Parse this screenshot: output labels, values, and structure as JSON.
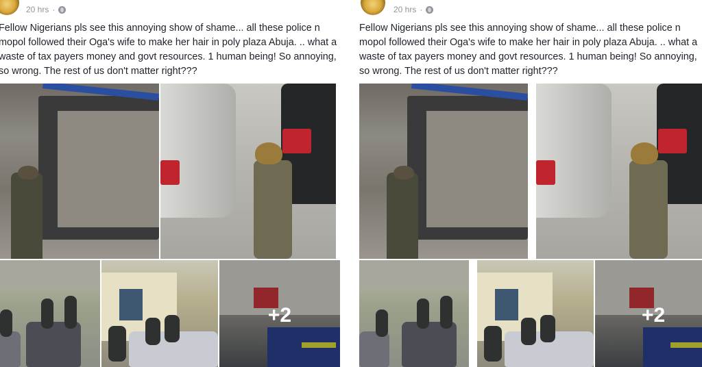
{
  "posts": [
    {
      "time": "20 hrs",
      "separator": "·",
      "privacy_icon": "globe-icon",
      "text": "Fellow Nigerians pls see this annoying show of shame... all these police n\nmopol followed their Oga's wife to make her hair in poly plaza Abuja. .. what a\nwaste of tax payers money and govt resources. 1 human being! So annoying,\nso wrong. The rest of us don't matter right???",
      "more_photos": "+2"
    },
    {
      "time": "20 hrs",
      "separator": "·",
      "privacy_icon": "globe-icon",
      "text": "Fellow Nigerians pls see this annoying show of shame... all these police n\nmopol followed their Oga's wife to make her hair in poly plaza Abuja. .. what a\nwaste of tax payers money and govt resources. 1 human being! So annoying,\nso wrong. The rest of us don't matter right???",
      "more_photos": "+2"
    }
  ],
  "colors": {
    "text": "#1d2129",
    "meta": "#90949c",
    "police_blue": "#2a3f8a"
  }
}
